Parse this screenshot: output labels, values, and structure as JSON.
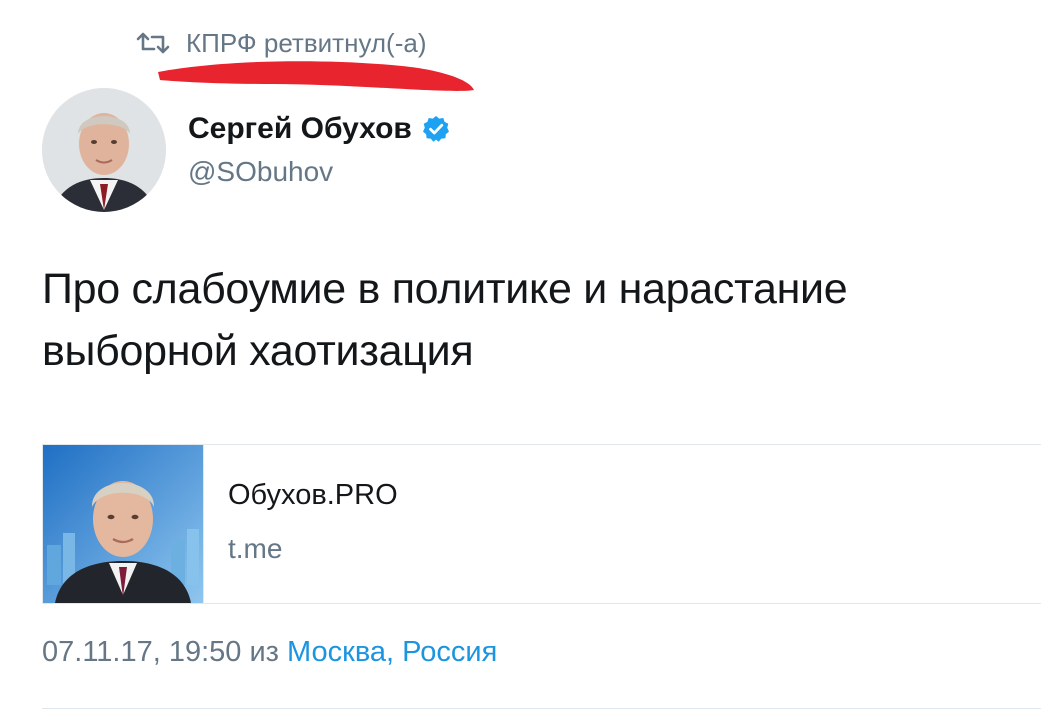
{
  "retweet": {
    "icon": "retweet-icon",
    "text": "КПРФ ретвитнул(-а)"
  },
  "author": {
    "name": "Сергей Обухов",
    "handle": "@SObuhov",
    "verified_icon": "verified-badge-icon"
  },
  "tweet": {
    "text_line1": "Про слабоумие в политике и нарастание",
    "text_line2": "выборной хаотизация"
  },
  "card": {
    "title": "Обухов.PRO",
    "domain": "t.me"
  },
  "meta": {
    "datetime": "07.11.17, 19:50",
    "from": "из",
    "location": "Москва, Россия"
  },
  "colors": {
    "text": "#14171a",
    "secondary": "#657786",
    "link": "#1b95e0",
    "verified": "#1da1f2",
    "redaction": "#e8252f",
    "divider": "#e1e8ed"
  }
}
